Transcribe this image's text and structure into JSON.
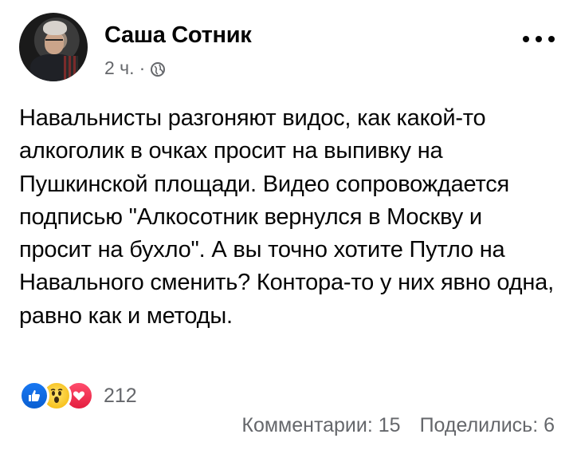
{
  "post": {
    "author": "Саша Сотник",
    "time": "2 ч.",
    "separator": "·",
    "text": "Навальнисты разгоняют видос, как какой-то алкоголик в очках просит на выпивку на Пушкинской площади. Видео сопровождается подписью \"Алкосотник вернулся в Москву и просит на бухло\". А вы точно хотите Путло на Навального сменить? Контора-то у них явно одна, равно как и методы."
  },
  "reactions": {
    "icons": [
      "like-icon",
      "wow-icon",
      "love-icon"
    ],
    "count": "212"
  },
  "stats": {
    "comments": "Комментарии: 15",
    "shares": "Поделились: 6"
  },
  "colors": {
    "text": "#050505",
    "secondary": "#65676b",
    "like": "#1877f2",
    "love": "#e41e3f",
    "wow": "#f7b928"
  }
}
